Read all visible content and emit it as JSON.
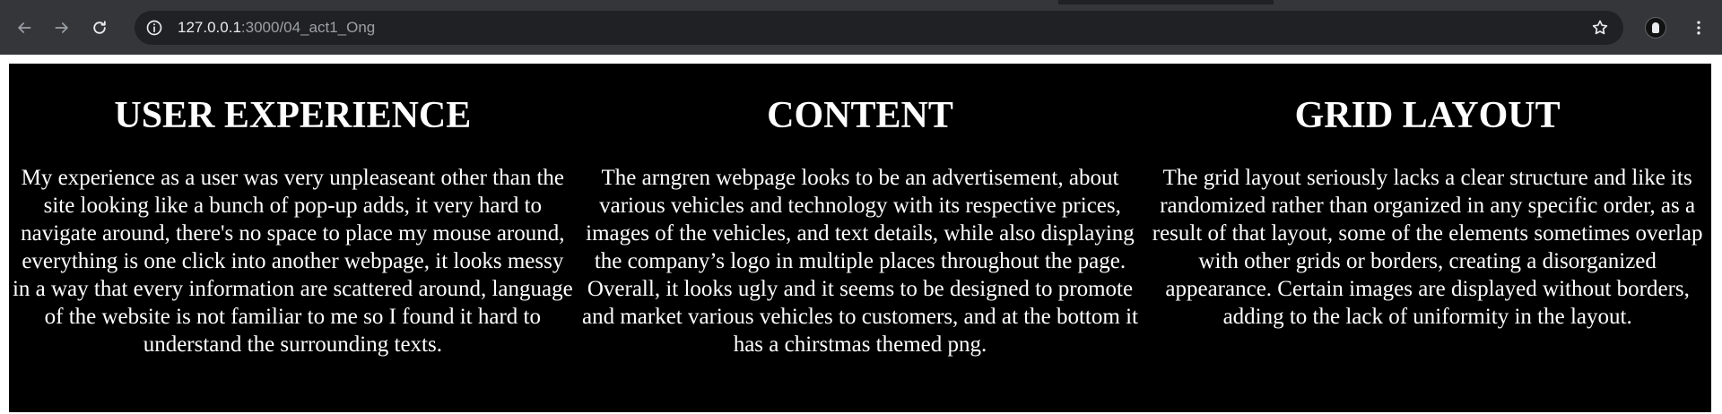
{
  "browser": {
    "url_host": "127.0.0.1",
    "url_path": ":3000/04_act1_Ong"
  },
  "icons": {
    "back": "back-arrow-icon",
    "forward": "forward-arrow-icon",
    "reload": "reload-icon",
    "site_info": "info-icon",
    "bookmark": "star-icon",
    "profile": "avatar",
    "menu": "kebab-menu-icon"
  },
  "colors": {
    "chrome_bg": "#35363a",
    "omnibox_bg": "#202124",
    "panel_bg": "#000000",
    "panel_text": "#ffffff"
  },
  "columns": [
    {
      "title": "USER EXPERIENCE",
      "body": "My experience as a user was very unpleaseant other than the site looking like a bunch of pop-up adds, it very hard to navigate around, there's no space to place my mouse around, everything is one click into another webpage, it looks messy in a way that every information are scattered around, language of the website is not familiar to me so I found it hard to understand the surrounding texts."
    },
    {
      "title": "CONTENT",
      "body": "The arngren webpage looks to be an advertisement, about various vehicles and technology with its respective prices, images of the vehicles, and text details, while also displaying the company’s logo in multiple places throughout the page. Overall, it looks ugly and it seems to be designed to promote and market various vehicles to customers, and at the bottom it has a chirstmas themed png."
    },
    {
      "title": "GRID LAYOUT",
      "body": "The grid layout seriously lacks a clear structure and like its randomized rather than organized in any specific order, as a result of that layout, some of the elements sometimes overlap with other grids or borders, creating a disorganized appearance. Certain images are displayed without borders, adding to the lack of uniformity in the layout."
    }
  ]
}
